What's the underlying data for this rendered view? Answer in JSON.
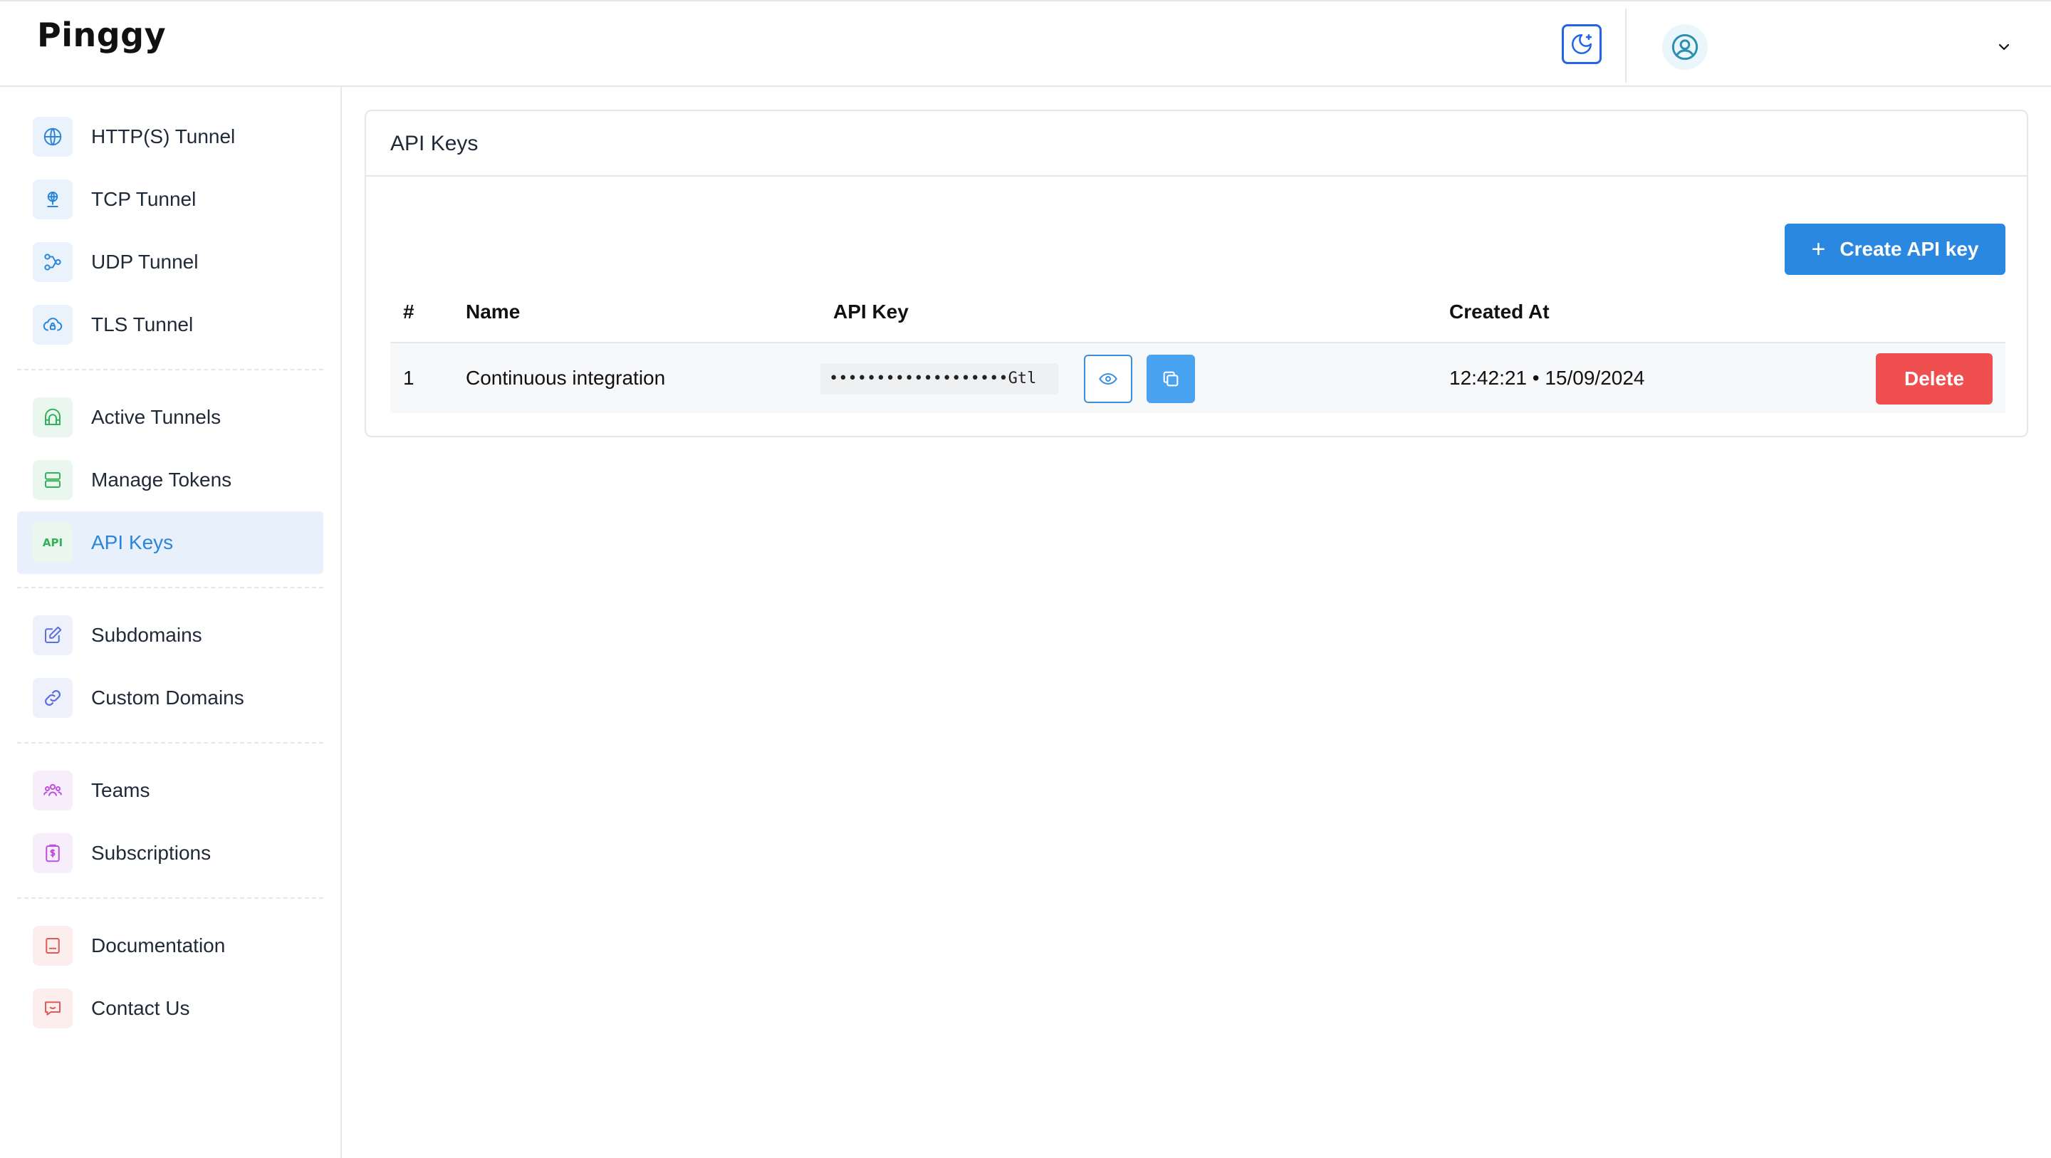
{
  "app": {
    "logo": "Pinggy"
  },
  "header": {
    "theme_toggle_icon": "moon-icon",
    "user_icon": "user-circle-icon",
    "user_menu_icon": "chevron-down-icon"
  },
  "sidebar": {
    "items": [
      {
        "label": "HTTP(S) Tunnel",
        "icon": "globe-www-icon",
        "color": "#2b86d9",
        "active": false
      },
      {
        "label": "TCP Tunnel",
        "icon": "network-icon",
        "color": "#2b86d9",
        "active": false
      },
      {
        "label": "UDP Tunnel",
        "icon": "share-nodes-icon",
        "color": "#2b86d9",
        "active": false
      },
      {
        "label": "TLS Tunnel",
        "icon": "cloud-lock-icon",
        "color": "#2b86d9",
        "active": false
      },
      {
        "label": "Active Tunnels",
        "icon": "tunnel-icon",
        "color": "#35b05a",
        "active": false
      },
      {
        "label": "Manage Tokens",
        "icon": "server-icon",
        "color": "#35b05a",
        "active": false
      },
      {
        "label": "API Keys",
        "icon": "api-icon",
        "icon_text": "API",
        "color": "#35b05a",
        "active": true
      },
      {
        "label": "Subdomains",
        "icon": "edit-icon",
        "color": "#5b6ee0",
        "active": false
      },
      {
        "label": "Custom Domains",
        "icon": "link-icon",
        "color": "#5b6ee0",
        "active": false
      },
      {
        "label": "Teams",
        "icon": "users-icon",
        "color": "#c04fe0",
        "active": false
      },
      {
        "label": "Subscriptions",
        "icon": "billing-icon",
        "color": "#c04fe0",
        "active": false
      },
      {
        "label": "Documentation",
        "icon": "book-icon",
        "color": "#e05a5a",
        "active": false
      },
      {
        "label": "Contact Us",
        "icon": "chat-icon",
        "color": "#e05a5a",
        "active": false
      }
    ]
  },
  "main": {
    "title": "API Keys",
    "create_button_label": "Create API key",
    "create_button_icon": "plus-icon",
    "table": {
      "columns": [
        "#",
        "Name",
        "API Key",
        "Created At"
      ],
      "rows": [
        {
          "index": "1",
          "name": "Continuous integration",
          "api_key_masked": "•••••••••••••••••••Gtl",
          "created_at": "12:42:21 • 15/09/2024",
          "delete_label": "Delete"
        }
      ]
    }
  },
  "colors": {
    "primary": "#2b88e0",
    "danger": "#f04f4f",
    "active_bg": "#e7f0fb"
  }
}
